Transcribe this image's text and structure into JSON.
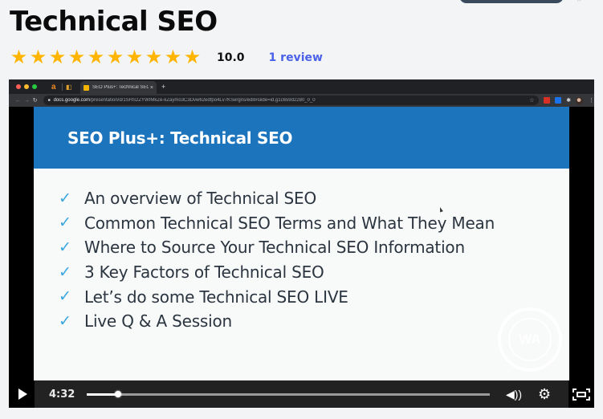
{
  "page": {
    "title": "Technical SEO",
    "rating": {
      "stars_filled": 10,
      "stars_total": 10,
      "score": "10.0",
      "reviews_link": "1 review"
    },
    "colors": {
      "star": "#ffb400",
      "link": "#4a62e8",
      "slide_header": "#1c74bc",
      "check": "#3aa6e0"
    }
  },
  "video": {
    "browser": {
      "tab_title": "SEO Plus+: Technical SEO - G",
      "tab_close": "×",
      "new_tab": "+",
      "url_host": "docs.google.com",
      "url_path": "/presentation/d/1SHS2ZYWIMkZe-kZaymo3C3Dvw62edfpo4Lv7KSergns/edit#slide=id.g1c659d2280_0_0",
      "icons": [
        "back-icon",
        "forward-icon",
        "reload-icon",
        "lock-icon",
        "bookmark-star-icon",
        "extension-icon",
        "extension-icon",
        "puzzle-icon",
        "profile-avatar",
        "kebab-menu-icon"
      ]
    },
    "slide": {
      "title": "SEO Plus+: Technical SEO",
      "items": [
        "An overview of Technical SEO",
        "Common Technical SEO Terms and What They Mean",
        "Where to Source Your Technical SEO Information",
        "3 Key Factors of Technical SEO",
        "Let’s do some Technical SEO LIVE",
        "Live Q & A Session"
      ],
      "check_glyph": "✓",
      "watermark_text": "WA"
    },
    "controls": {
      "current_time": "4:32",
      "progress_percent": 7.8,
      "play_icon": "play-icon",
      "volume_glyph": "◀))",
      "settings_glyph": "⚙"
    }
  }
}
